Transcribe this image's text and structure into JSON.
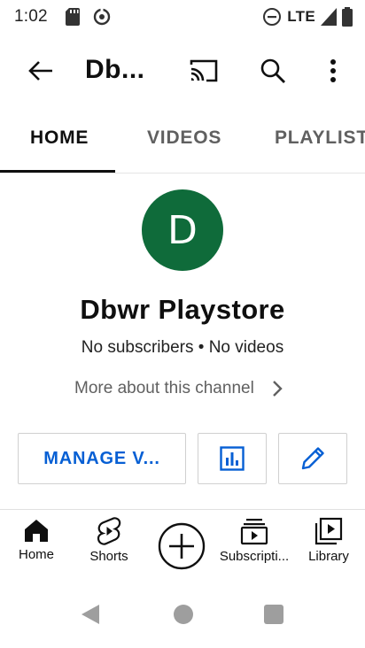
{
  "status_bar": {
    "time": "1:02",
    "network": "LTE"
  },
  "app_bar": {
    "channel_title_truncated": "Db..."
  },
  "tabs": [
    {
      "label": "HOME",
      "active": true
    },
    {
      "label": "VIDEOS",
      "active": false
    },
    {
      "label": "PLAYLISTS",
      "active": false
    }
  ],
  "channel": {
    "avatar_letter": "D",
    "avatar_color": "#0f6b3a",
    "name": "Dbwr Playstore",
    "stats": "No subscribers • No videos",
    "more_about": "More about this channel"
  },
  "actions": {
    "manage_label": "MANAGE V...",
    "accent_color": "#065fd4"
  },
  "bottom_nav": {
    "home": "Home",
    "shorts": "Shorts",
    "subscriptions": "Subscripti...",
    "library": "Library"
  },
  "icons": {
    "back": "arrow-back-icon",
    "cast": "cast-icon",
    "search": "search-icon",
    "more": "more-vert-icon",
    "analytics": "analytics-icon",
    "edit": "pencil-icon",
    "create": "add-circle-icon"
  }
}
